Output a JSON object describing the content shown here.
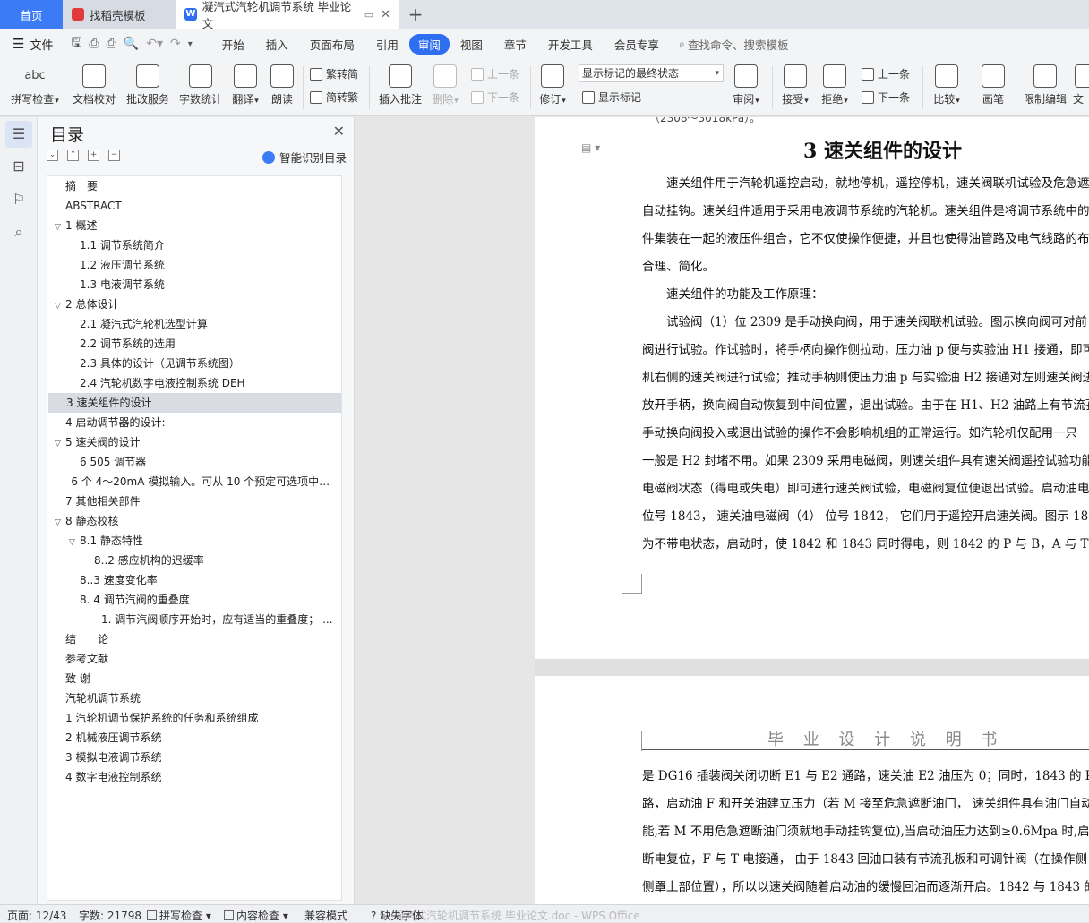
{
  "tabs": {
    "home": "首页",
    "template": "找稻壳模板",
    "doc": "凝汽式汽轮机调节系统 毕业论文",
    "plus": "+"
  },
  "menu": {
    "file": "文件",
    "items": [
      "开始",
      "插入",
      "页面布局",
      "引用",
      "审阅",
      "视图",
      "章节",
      "开发工具",
      "会员专享"
    ],
    "search": "查找命令、搜索模板"
  },
  "ribbon": {
    "spell_check": "拼写检查",
    "doc_proof": "文档校对",
    "batch_service": "批改服务",
    "word_count": "字数统计",
    "translate": "翻译",
    "read_aloud": "朗读",
    "trad_to_simp": "繁转简",
    "simp_to_trad": "简转繁",
    "insert_comment": "插入批注",
    "delete": "删除",
    "prev_comment": "上一条",
    "next_comment": "下一条",
    "revise": "修订",
    "markup_select": "显示标记的最终状态",
    "show_markup": "显示标记",
    "review": "审阅",
    "accept": "接受",
    "reject": "拒绝",
    "prev_change": "上一条",
    "next_change": "下一条",
    "compare": "比较",
    "pen": "画笔",
    "restrict_edit": "限制编辑",
    "doc_perm": "文"
  },
  "toc": {
    "title": "目录",
    "smart": "智能识别目录",
    "items": [
      {
        "label": "摘　要",
        "indent": 0
      },
      {
        "label": "ABSTRACT",
        "indent": 0
      },
      {
        "label": "1  概述",
        "indent": 0,
        "arrow": true
      },
      {
        "label": "1.1 调节系统简介",
        "indent": 1
      },
      {
        "label": "1.2 液压调节系统",
        "indent": 1
      },
      {
        "label": "1.3 电液调节系统",
        "indent": 1
      },
      {
        "label": "2  总体设计",
        "indent": 0,
        "arrow": true
      },
      {
        "label": "2.1 凝汽式汽轮机选型计算",
        "indent": 1
      },
      {
        "label": "2.2 调节系统的选用",
        "indent": 1
      },
      {
        "label": "2.3 具体的设计（见调节系统图）",
        "indent": 1
      },
      {
        "label": "2.4 汽轮机数字电液控制系统 DEH",
        "indent": 1
      },
      {
        "label": "3 速关组件的设计",
        "indent": 0,
        "selected": true
      },
      {
        "label": "4 启动调节器的设计:",
        "indent": 0
      },
      {
        "label": "5 速关阀的设计",
        "indent": 0,
        "arrow": true
      },
      {
        "label": "6    505 调节器",
        "indent": 1
      },
      {
        "label": "6 个 4～20mA 模拟输入。可从 10 个预定可选项中选...",
        "indent": 0.4
      },
      {
        "label": "7 其他相关部件",
        "indent": 0
      },
      {
        "label": "8 静态校核",
        "indent": 0,
        "arrow": true
      },
      {
        "label": "8.1 静态特性",
        "indent": 1,
        "arrow": true
      },
      {
        "label": "8..2 感应机构的迟缓率",
        "indent": 2
      },
      {
        "label": "8..3 速度变化率",
        "indent": 1
      },
      {
        "label": "8. 4 调节汽阀的重叠度",
        "indent": 1
      },
      {
        "label": "1.  调节汽阀顺序开始时，应有适当的重叠度；  ...",
        "indent": 2.5
      },
      {
        "label": "结　　论",
        "indent": 0
      },
      {
        "label": "参考文献",
        "indent": 0
      },
      {
        "label": "致  谢",
        "indent": 0
      },
      {
        "label": "汽轮机调节系统",
        "indent": 0
      },
      {
        "label": "1 汽轮机调节保护系统的任务和系统组成",
        "indent": 0
      },
      {
        "label": "2 机械液压调节系统",
        "indent": 0
      },
      {
        "label": "3 模拟电液调节系统",
        "indent": 0
      },
      {
        "label": "4  数字电液控制系统",
        "indent": 0
      }
    ]
  },
  "document": {
    "cut_text": "（2308～3018kPa）。",
    "heading": "3 速关组件的设计",
    "page1_lines": [
      "　　速关组件用于汽轮机遥控启动，就地停机，遥控停机，速关阀联机试验及危急遮",
      "自动挂钩。速关组件适用于采用电液调节系统的汽轮机。速关组件是将调节系统中的",
      "件集装在一起的液压件组合，它不仅使操作便捷，并且也使得油管路及电气线路的布",
      "合理、简化。",
      "　　速关组件的功能及工作原理：",
      "　　试验阀（1）位 2309 是手动换向阀，用于速关阀联机试验。图示换向阀可对前",
      "阀进行试验。作试验时，将手柄向操作侧拉动，压力油 p 便与实验油 H1 接通，即可",
      "机右侧的速关阀进行试验；推动手柄则使压力油 p 与实验油 H2 接通对左则速关阀进",
      "放开手柄，换向阀自动恢复到中间位置，退出试验。由于在 H1、H2 油路上有节流孔",
      "手动换向阀投入或退出试验的操作不会影响机组的正常运行。如汽轮机仅配用一只",
      "一般是 H2 封堵不用。如果 2309 采用电磁阀，则速关组件具有速关阀遥控试验功能",
      "电磁阀状态（得电或失电）即可进行速关阀试验，电磁阀复位便退出试验。启动油电",
      "位号 1843，  速关油电磁阀（4）  位号 1842，  它们用于遥控开启速关阀。图示 1843",
      "为不带电状态，启动时，使 1842 和 1843 同时得电，则 1842 的 P 与 B，A 与 T 通"
    ],
    "page2_header": "毕 业 设 计 说  明 书",
    "page2_lines": [
      "是 DG16 插装阀关闭切断 E1 与 E2 通路，速关油 E2 油压为 0；同时，1843 的 P 与",
      "路，启动油 F 和开关油建立压力（若 M 接至危急遮断油门，  速关组件具有油门自动",
      "能,若 M 不用危急遮断油门须就地手动挂钩复位),当启动油压力达到≥0.6Mpa 时,启",
      "断电复位，F 与 T 电接通，  由于 1843 回油口装有节流孔板和可调针阀（在操作侧",
      "侧罩上部位置），所以以速关阀随着启动油的缓慢回油而逐渐开启。1842 与 1843 的"
    ]
  },
  "status": {
    "page": "页面: 12/43",
    "words": "字数: 21798",
    "spell": "拼写检查",
    "content": "内容检查",
    "compat": "兼容模式",
    "missing_font": "缺失字体",
    "ghost": "凝汽式汽轮机调节系统 毕业论文.doc - WPS Office"
  }
}
